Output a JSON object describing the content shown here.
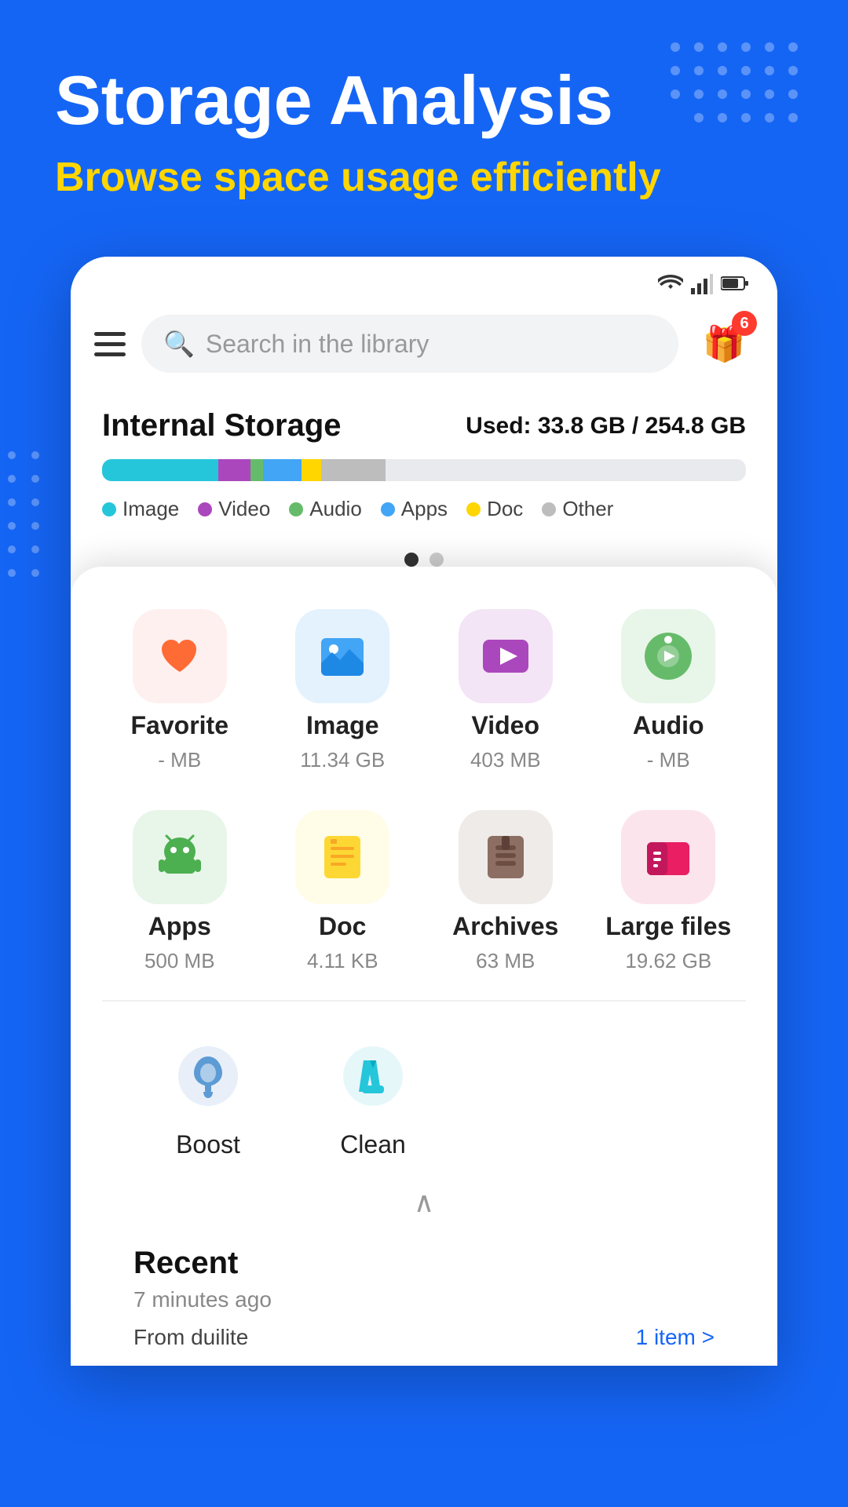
{
  "page": {
    "title": "Storage Analysis",
    "subtitle": "Browse space usage efficiently",
    "background_color": "#1565F5",
    "accent_color": "#FFD600"
  },
  "status_bar": {
    "wifi_icon": "wifi",
    "signal_icon": "signal",
    "battery_icon": "battery"
  },
  "top_bar": {
    "menu_icon": "hamburger",
    "search_placeholder": "Search in the library",
    "gift_count": "6"
  },
  "storage": {
    "label": "Internal Storage",
    "used_prefix": "Used:",
    "used_value": "33.8 GB / 254.8 GB",
    "legend": [
      {
        "name": "Image",
        "color": "#26C6DA",
        "class": "dot-image"
      },
      {
        "name": "Video",
        "color": "#AB47BC",
        "class": "dot-video"
      },
      {
        "name": "Audio",
        "color": "#66BB6A",
        "class": "dot-audio"
      },
      {
        "name": "Apps",
        "color": "#42A5F5",
        "class": "dot-apps"
      },
      {
        "name": "Doc",
        "color": "#FFD600",
        "class": "dot-doc"
      },
      {
        "name": "Other",
        "color": "#BDBDBD",
        "class": "dot-other"
      }
    ]
  },
  "categories": [
    {
      "name": "Favorite",
      "size": "- MB",
      "icon_type": "favorite",
      "icon_bg": "#FFF0F0"
    },
    {
      "name": "Image",
      "size": "11.34 GB",
      "icon_type": "image",
      "icon_bg": "#E3F2FD"
    },
    {
      "name": "Video",
      "size": "403 MB",
      "icon_type": "video",
      "icon_bg": "#F3E5F5"
    },
    {
      "name": "Audio",
      "size": "- MB",
      "icon_type": "audio",
      "icon_bg": "#E8F5E9"
    },
    {
      "name": "Apps",
      "size": "500 MB",
      "icon_type": "apps",
      "icon_bg": "#E8F5E9"
    },
    {
      "name": "Doc",
      "size": "4.11 KB",
      "icon_type": "doc",
      "icon_bg": "#FFFDE7"
    },
    {
      "name": "Archives",
      "size": "63 MB",
      "icon_type": "archives",
      "icon_bg": "#EFEBE9"
    },
    {
      "name": "Large files",
      "size": "19.62 GB",
      "icon_type": "large",
      "icon_bg": "#FCE4EC"
    }
  ],
  "tools": [
    {
      "name": "Boost",
      "icon_type": "rocket"
    },
    {
      "name": "Clean",
      "icon_type": "broom"
    }
  ],
  "recent": {
    "title": "Recent",
    "time": "7 minutes ago",
    "from": "From duilite",
    "item_count": "1 item >"
  }
}
